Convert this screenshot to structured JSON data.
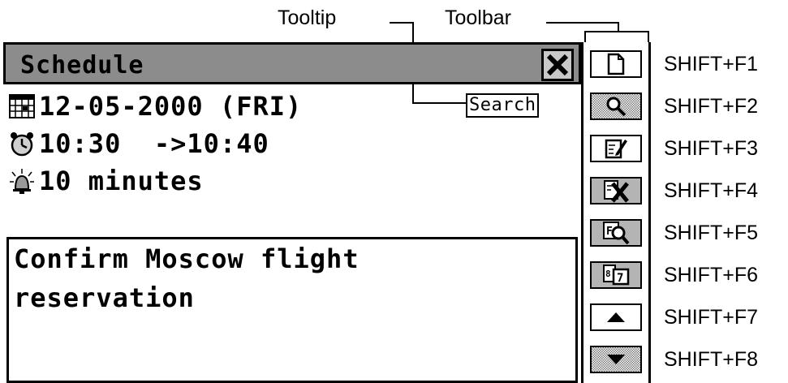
{
  "annotations": {
    "tooltip_label": "Tooltip",
    "toolbar_label": "Toolbar"
  },
  "window": {
    "title": "Schedule",
    "close_icon": "close-x-icon"
  },
  "schedule": {
    "date": "12-05-2000 (FRI)",
    "time": "10:30  ->10:40",
    "alarm": "10 minutes",
    "note_line1": "Confirm Moscow flight",
    "note_line2": "reservation"
  },
  "tooltip": {
    "text": "Search"
  },
  "toolbar": {
    "buttons": [
      {
        "icon": "new-document-icon",
        "shortcut": "SHIFT+F1"
      },
      {
        "icon": "search-icon",
        "shortcut": "SHIFT+F2"
      },
      {
        "icon": "edit-icon",
        "shortcut": "SHIFT+F3"
      },
      {
        "icon": "delete-icon",
        "shortcut": "SHIFT+F4"
      },
      {
        "icon": "find-in-view-icon",
        "shortcut": "SHIFT+F5"
      },
      {
        "icon": "calendar-toggle-icon",
        "shortcut": "SHIFT+F6"
      },
      {
        "icon": "arrow-up-icon",
        "shortcut": "SHIFT+F7"
      },
      {
        "icon": "arrow-down-icon",
        "shortcut": "SHIFT+F8"
      }
    ]
  }
}
